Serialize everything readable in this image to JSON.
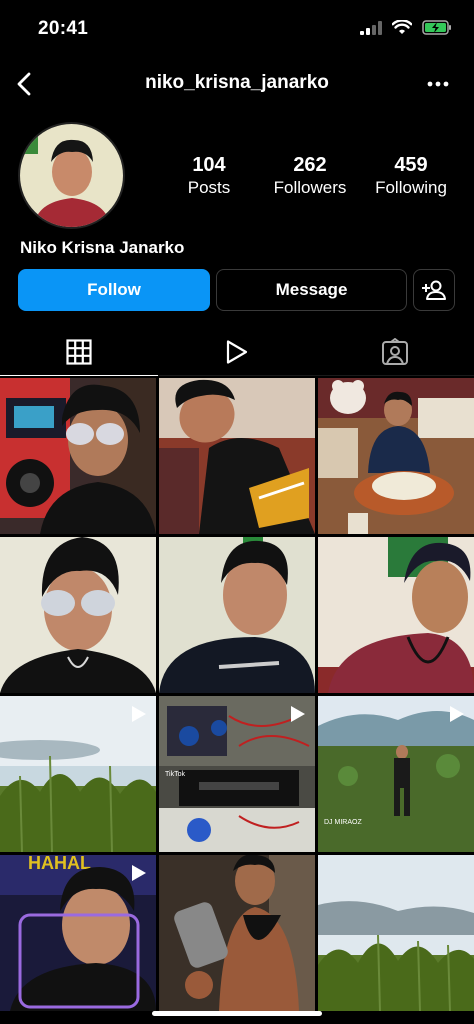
{
  "status_bar": {
    "time": "20:41",
    "icons": [
      "signal-icon",
      "wifi-icon",
      "battery-charging-icon"
    ]
  },
  "header": {
    "username": "niko_krisna_janarko",
    "back_icon": "chevron-left-icon",
    "more_icon": "more-horizontal-icon"
  },
  "profile": {
    "display_name": "Niko Krisna Janarko",
    "stats": [
      {
        "value": "104",
        "label": "Posts"
      },
      {
        "value": "262",
        "label": "Followers"
      },
      {
        "value": "459",
        "label": "Following"
      }
    ]
  },
  "actions": {
    "follow": "Follow",
    "message": "Message",
    "suggest_icon": "add-person-icon"
  },
  "colors": {
    "accent": "#0a95f6",
    "background": "#000000",
    "border": "#3a3a3a"
  },
  "tabs": [
    {
      "icon": "grid-icon",
      "active": true
    },
    {
      "icon": "reels-icon",
      "active": false
    },
    {
      "icon": "tagged-icon",
      "active": false
    }
  ],
  "posts": [
    {
      "type": "photo"
    },
    {
      "type": "photo"
    },
    {
      "type": "photo"
    },
    {
      "type": "photo"
    },
    {
      "type": "photo"
    },
    {
      "type": "photo"
    },
    {
      "type": "reel"
    },
    {
      "type": "reel",
      "overlay_text": "TikTok"
    },
    {
      "type": "reel",
      "overlay_text": "DJ MIRAOZ"
    },
    {
      "type": "photo",
      "overlay_text": "HAHAL"
    },
    {
      "type": "reel"
    },
    {
      "type": "photo"
    }
  ]
}
